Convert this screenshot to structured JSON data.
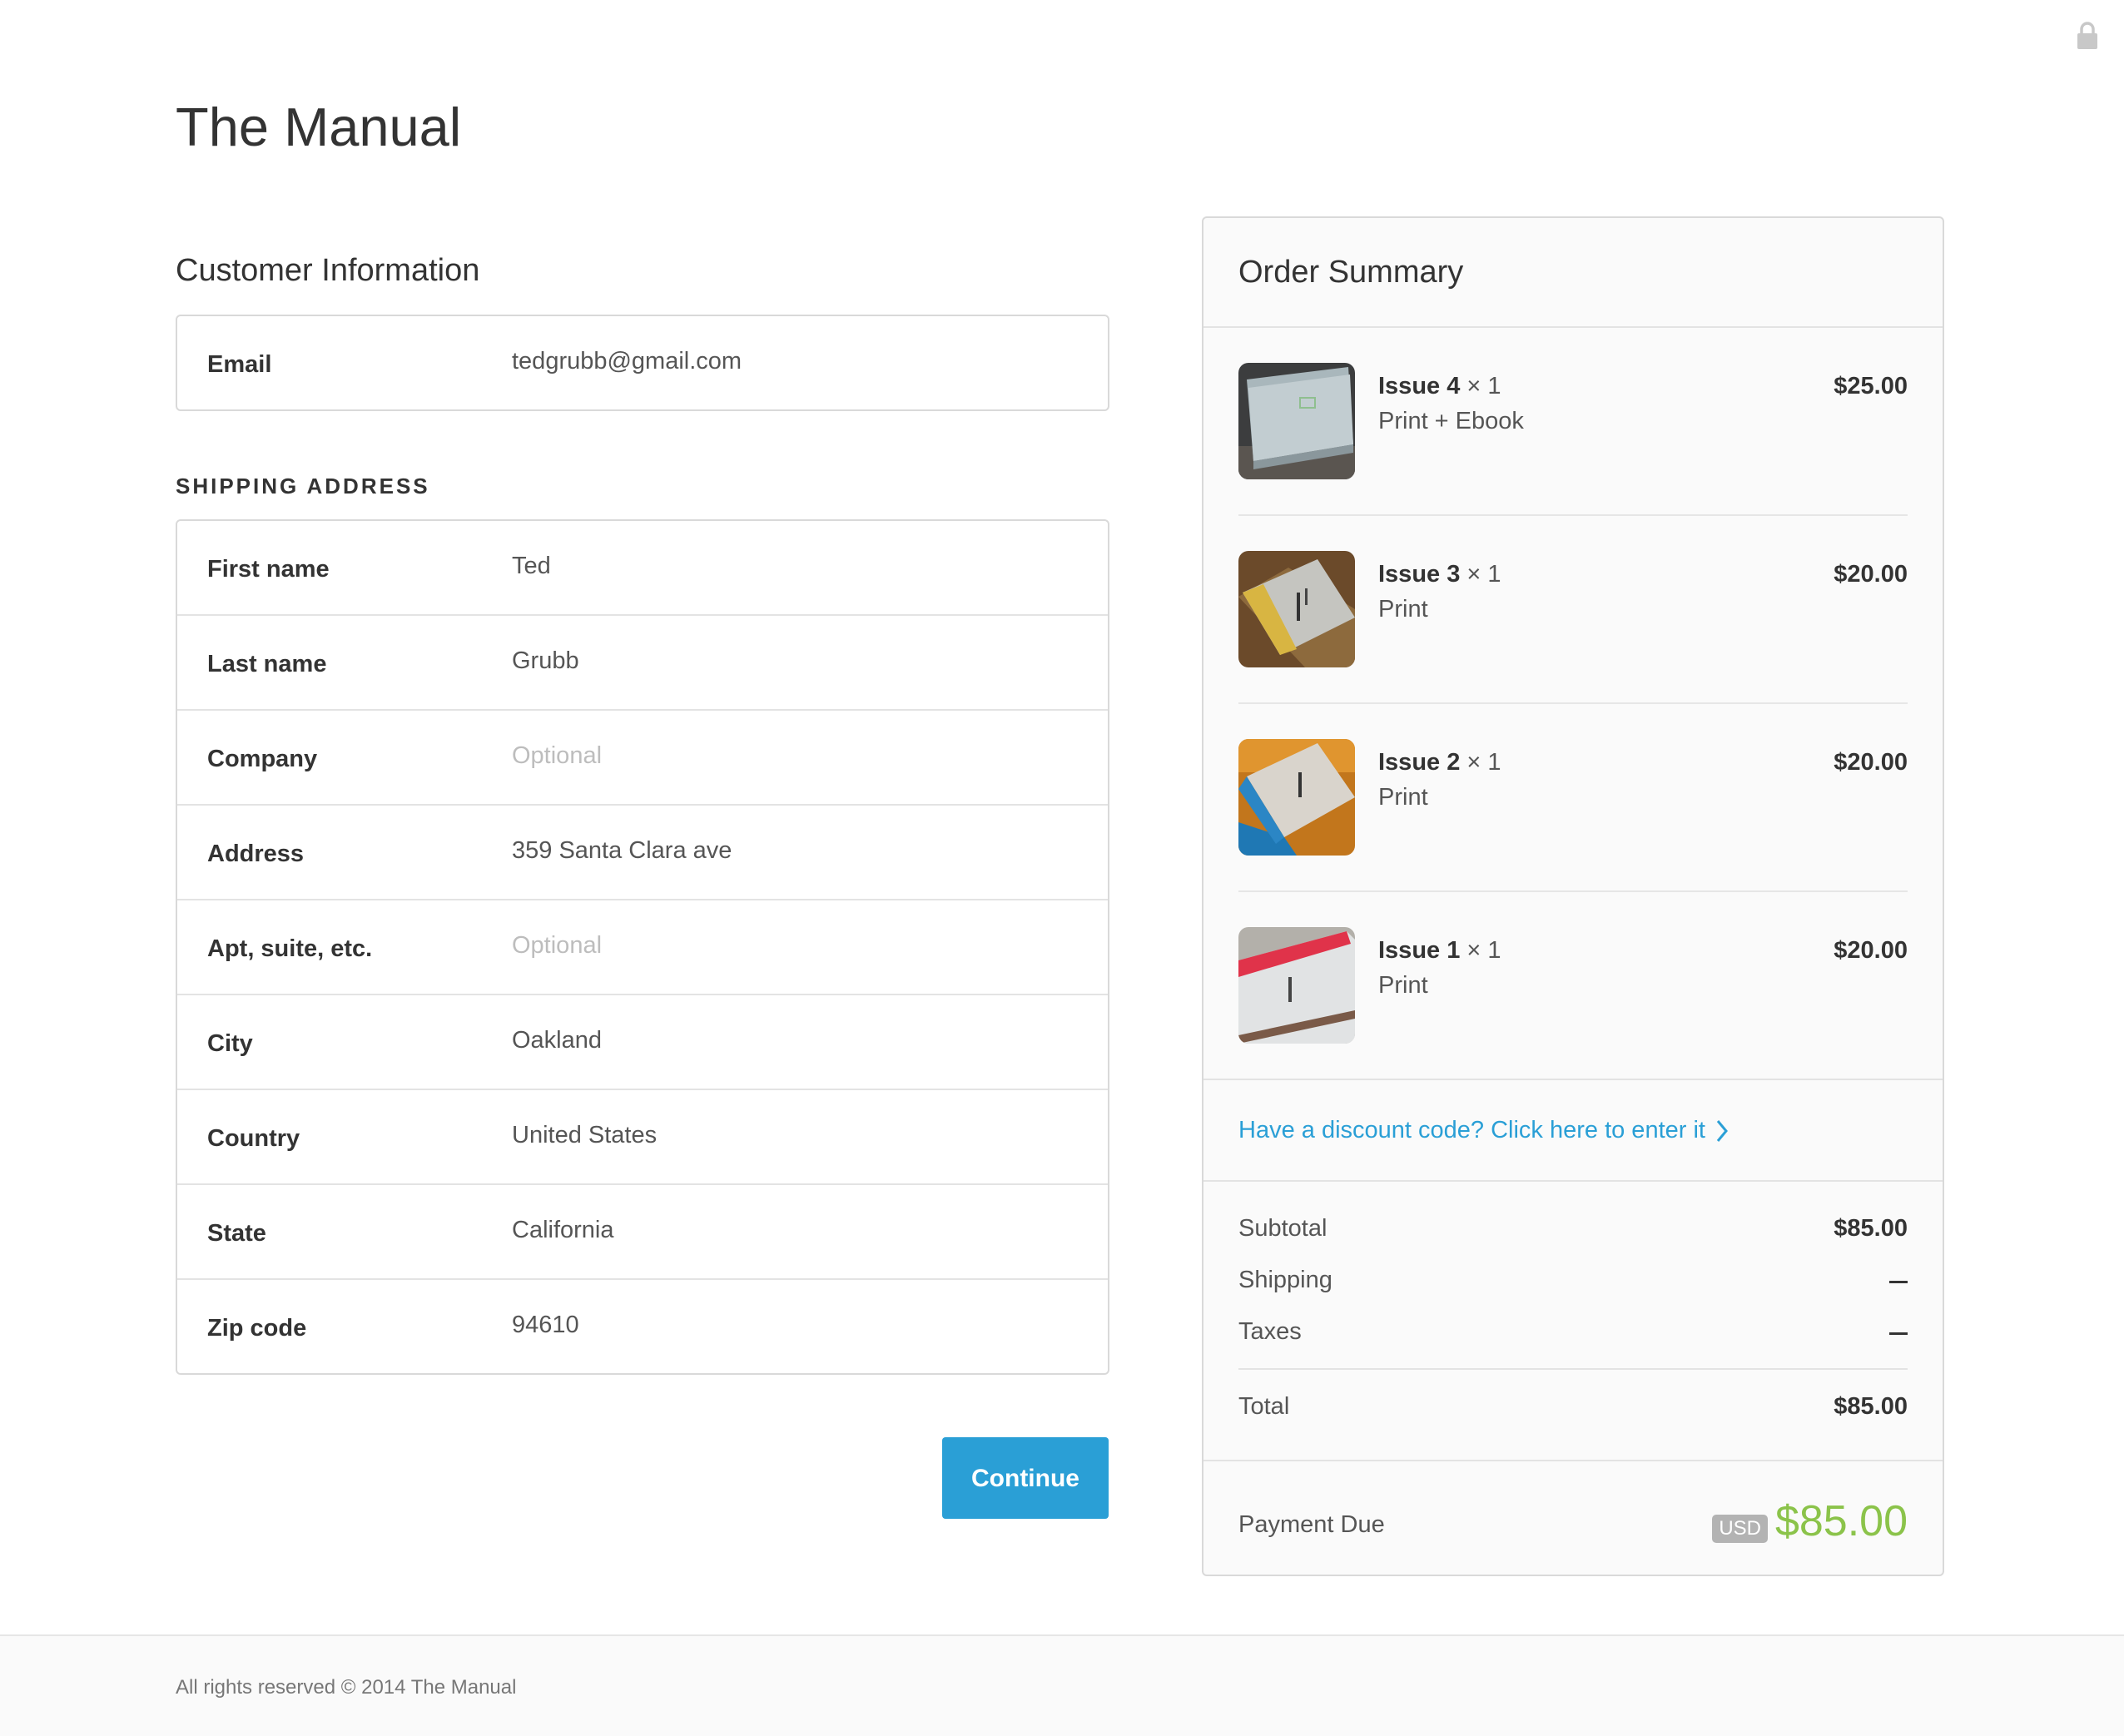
{
  "header": {
    "brand": "The Manual",
    "lock_icon": "lock-icon"
  },
  "customer": {
    "title": "Customer Information",
    "email": {
      "label": "Email",
      "value": "tedgrubb@gmail.com"
    }
  },
  "shipping": {
    "title": "SHIPPING ADDRESS",
    "fields": [
      {
        "label": "First name",
        "value": "Ted",
        "placeholder": false
      },
      {
        "label": "Last name",
        "value": "Grubb",
        "placeholder": false
      },
      {
        "label": "Company",
        "value": "Optional",
        "placeholder": true
      },
      {
        "label": "Address",
        "value": "359 Santa Clara ave",
        "placeholder": false
      },
      {
        "label": "Apt, suite, etc.",
        "value": "Optional",
        "placeholder": true
      },
      {
        "label": "City",
        "value": "Oakland",
        "placeholder": false
      },
      {
        "label": "Country",
        "value": "United States",
        "placeholder": false
      },
      {
        "label": "State",
        "value": "California",
        "placeholder": false
      },
      {
        "label": "Zip code",
        "value": "94610",
        "placeholder": false
      }
    ]
  },
  "actions": {
    "continue_label": "Continue"
  },
  "summary": {
    "title": "Order Summary",
    "items": [
      {
        "name": "Issue 4",
        "qty": "× 1",
        "variant": "Print + Ebook",
        "price": "$25.00"
      },
      {
        "name": "Issue 3",
        "qty": "× 1",
        "variant": "Print",
        "price": "$20.00"
      },
      {
        "name": "Issue 2",
        "qty": "× 1",
        "variant": "Print",
        "price": "$20.00"
      },
      {
        "name": "Issue 1",
        "qty": "× 1",
        "variant": "Print",
        "price": "$20.00"
      }
    ],
    "discount_link": "Have a discount code? Click here to enter it",
    "subtotal": {
      "label": "Subtotal",
      "value": "$85.00"
    },
    "shipping": {
      "label": "Shipping",
      "value": "—"
    },
    "taxes": {
      "label": "Taxes",
      "value": "—"
    },
    "total": {
      "label": "Total",
      "value": "$85.00"
    },
    "payment_due": {
      "label": "Payment Due",
      "currency": "USD",
      "amount": "$85.00"
    }
  },
  "footer": {
    "text": "All rights reserved © 2014 The Manual"
  },
  "colors": {
    "accent": "#2a9fd6",
    "due": "#8bc34a",
    "border": "#d9d9d9"
  }
}
